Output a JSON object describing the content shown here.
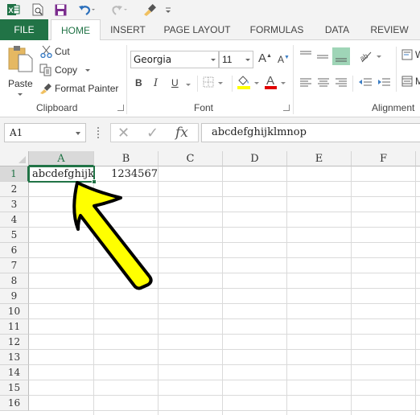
{
  "quick_access": {
    "icons": [
      "excel-logo-icon",
      "print-preview-icon",
      "save-icon",
      "undo-icon",
      "redo-icon",
      "format-painter-icon",
      "customize-qat-icon"
    ]
  },
  "tabs": {
    "file": "FILE",
    "items": [
      "HOME",
      "INSERT",
      "PAGE LAYOUT",
      "FORMULAS",
      "DATA",
      "REVIEW"
    ],
    "active": "HOME"
  },
  "ribbon": {
    "clipboard": {
      "label": "Clipboard",
      "paste": "Paste",
      "cut": "Cut",
      "copy": "Copy",
      "format_painter": "Format Painter"
    },
    "font": {
      "label": "Font",
      "font_name": "Georgia",
      "font_size": "11",
      "bold": "B",
      "italic": "I",
      "underline": "U",
      "grow": "A",
      "shrink": "A",
      "font_color_letter": "A",
      "fill_color": "#ffff00",
      "font_color": "#e00000"
    },
    "alignment": {
      "label": "Alignment",
      "wrap_text_partial": "W",
      "merge_partial": "M"
    }
  },
  "formula_bar": {
    "name_box": "A1",
    "cancel": "✕",
    "enter": "✓",
    "fx": "fx",
    "value": "abcdefghijklmnop"
  },
  "sheet": {
    "columns": [
      "A",
      "B",
      "C",
      "D",
      "E",
      "F"
    ],
    "rows": [
      "1",
      "2",
      "3",
      "4",
      "5",
      "6",
      "7",
      "8",
      "9",
      "10",
      "11",
      "12",
      "13",
      "14",
      "15",
      "16"
    ],
    "selected_cell": "A1",
    "cells": {
      "A1": "abcdefghijk",
      "B1": "1234567"
    }
  },
  "annotation": {
    "arrow_color": "#ffff00",
    "arrow_outline": "#000000",
    "points_to": "A1"
  },
  "colors": {
    "accent": "#217346"
  }
}
